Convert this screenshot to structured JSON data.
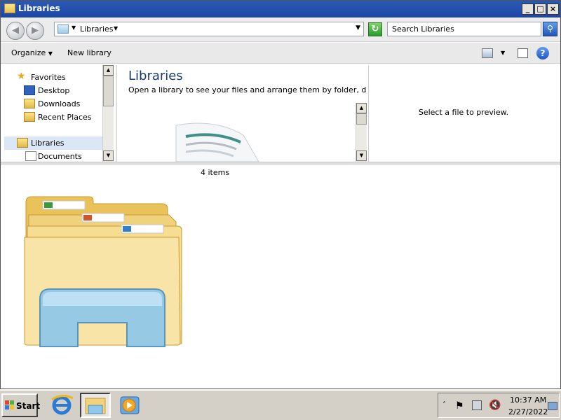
{
  "window": {
    "title": "Libraries"
  },
  "address": {
    "crumb": "Libraries",
    "search_placeholder": "Search Libraries"
  },
  "commands": {
    "organize": "Organize",
    "new_library": "New library"
  },
  "nav": {
    "favorites": "Favorites",
    "desktop": "Desktop",
    "downloads": "Downloads",
    "recent": "Recent Places",
    "libraries": "Libraries",
    "documents": "Documents"
  },
  "content": {
    "title": "Libraries",
    "description": "Open a library to see your files and arrange them by folder, d...",
    "preview_text": "Select a file to preview.",
    "count": "4 items"
  },
  "taskbar": {
    "start_label": "Start",
    "clock_time": "10:37 AM",
    "clock_date": "2/27/2022"
  },
  "colors": {
    "titlebar": "#2a59b4",
    "taskbar": "#d4d0c8",
    "accent": "#1a3b6e"
  }
}
